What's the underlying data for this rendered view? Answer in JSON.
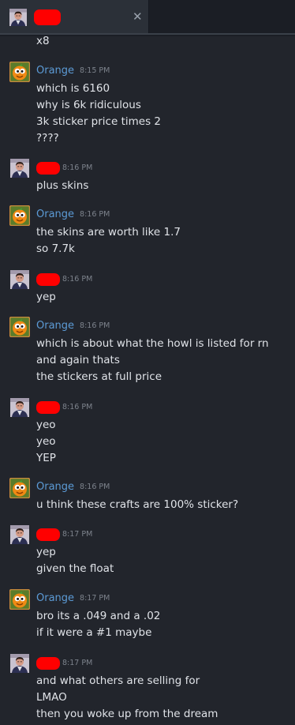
{
  "tab": {
    "icon": "user-avatar-icon",
    "close_label": "✕"
  },
  "colors": {
    "background": "#22252c",
    "name_color": "#5c9bd6",
    "time_color": "#7d838c",
    "text_color": "#e0e3e8",
    "redaction": "#ff0000"
  },
  "continuation": {
    "line": "x8"
  },
  "messages": [
    {
      "sender": "Orange",
      "time": "8:15 PM",
      "lines": [
        "which is 6160",
        "why is 6k ridiculous",
        "3k sticker price times 2",
        "????"
      ]
    },
    {
      "sender": "",
      "redacted": true,
      "time": "8:16 PM",
      "lines": [
        "plus skins"
      ]
    },
    {
      "sender": "Orange",
      "time": "8:16 PM",
      "lines": [
        "the skins are worth like 1.7",
        "so 7.7k"
      ]
    },
    {
      "sender": "",
      "redacted": true,
      "time": "8:16 PM",
      "lines": [
        "yep"
      ]
    },
    {
      "sender": "Orange",
      "time": "8:16 PM",
      "lines": [
        "which is about what the howl is listed for rn",
        "and again thats",
        "the stickers at full price"
      ]
    },
    {
      "sender": "",
      "redacted": true,
      "time": "8:16 PM",
      "lines": [
        "yeo",
        "yeo",
        "YEP"
      ]
    },
    {
      "sender": "Orange",
      "time": "8:16 PM",
      "lines": [
        "u think these crafts are 100% sticker?"
      ]
    },
    {
      "sender": "",
      "redacted": true,
      "time": "8:17 PM",
      "lines": [
        "yep",
        "given the float"
      ]
    },
    {
      "sender": "Orange",
      "time": "8:17 PM",
      "lines": [
        "bro its a .049 and a .02",
        "if it were a #1 maybe"
      ]
    },
    {
      "sender": "",
      "redacted": true,
      "time": "8:17 PM",
      "lines": [
        "and what others are selling for",
        "LMAO",
        "then you woke up from the dream"
      ]
    }
  ]
}
